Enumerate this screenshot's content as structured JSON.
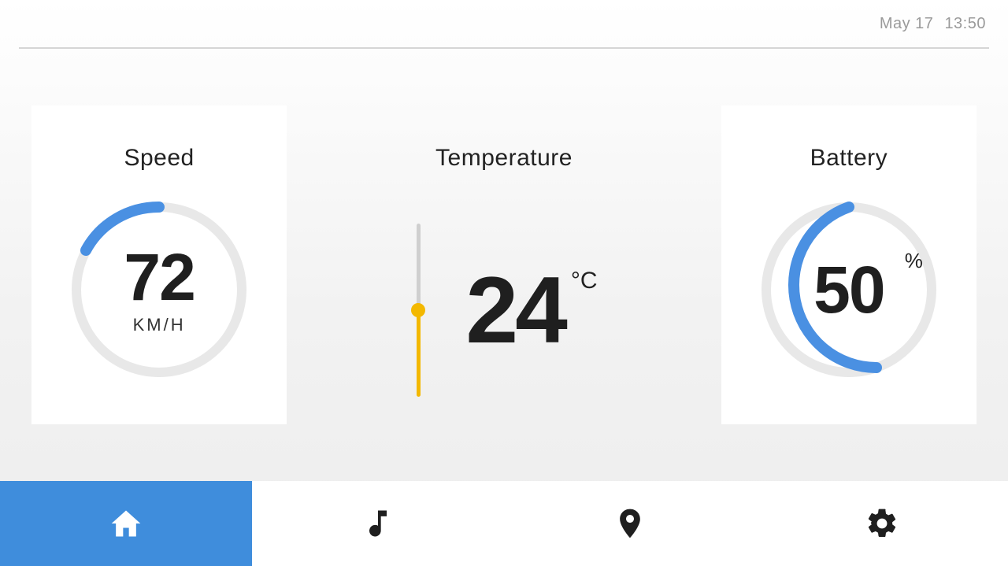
{
  "header": {
    "date": "May 17",
    "time": "13:50"
  },
  "cards": {
    "speed": {
      "title": "Speed",
      "value": "72",
      "unit": "KM/H",
      "arc_percent": 20
    },
    "temperature": {
      "title": "Temperature",
      "value": "24",
      "unit": "°C",
      "fill_percent": 50
    },
    "battery": {
      "title": "Battery",
      "value": "50",
      "unit": "%",
      "arc_percent": 60
    }
  },
  "colors": {
    "accent_blue": "#3f8ddc",
    "gauge_track": "#e5e5e5",
    "gauge_blue": "#4a90e2",
    "thermo_yellow": "#f3b800"
  },
  "nav": {
    "active_index": 0,
    "items": [
      {
        "name": "home"
      },
      {
        "name": "music"
      },
      {
        "name": "location"
      },
      {
        "name": "settings"
      }
    ]
  }
}
